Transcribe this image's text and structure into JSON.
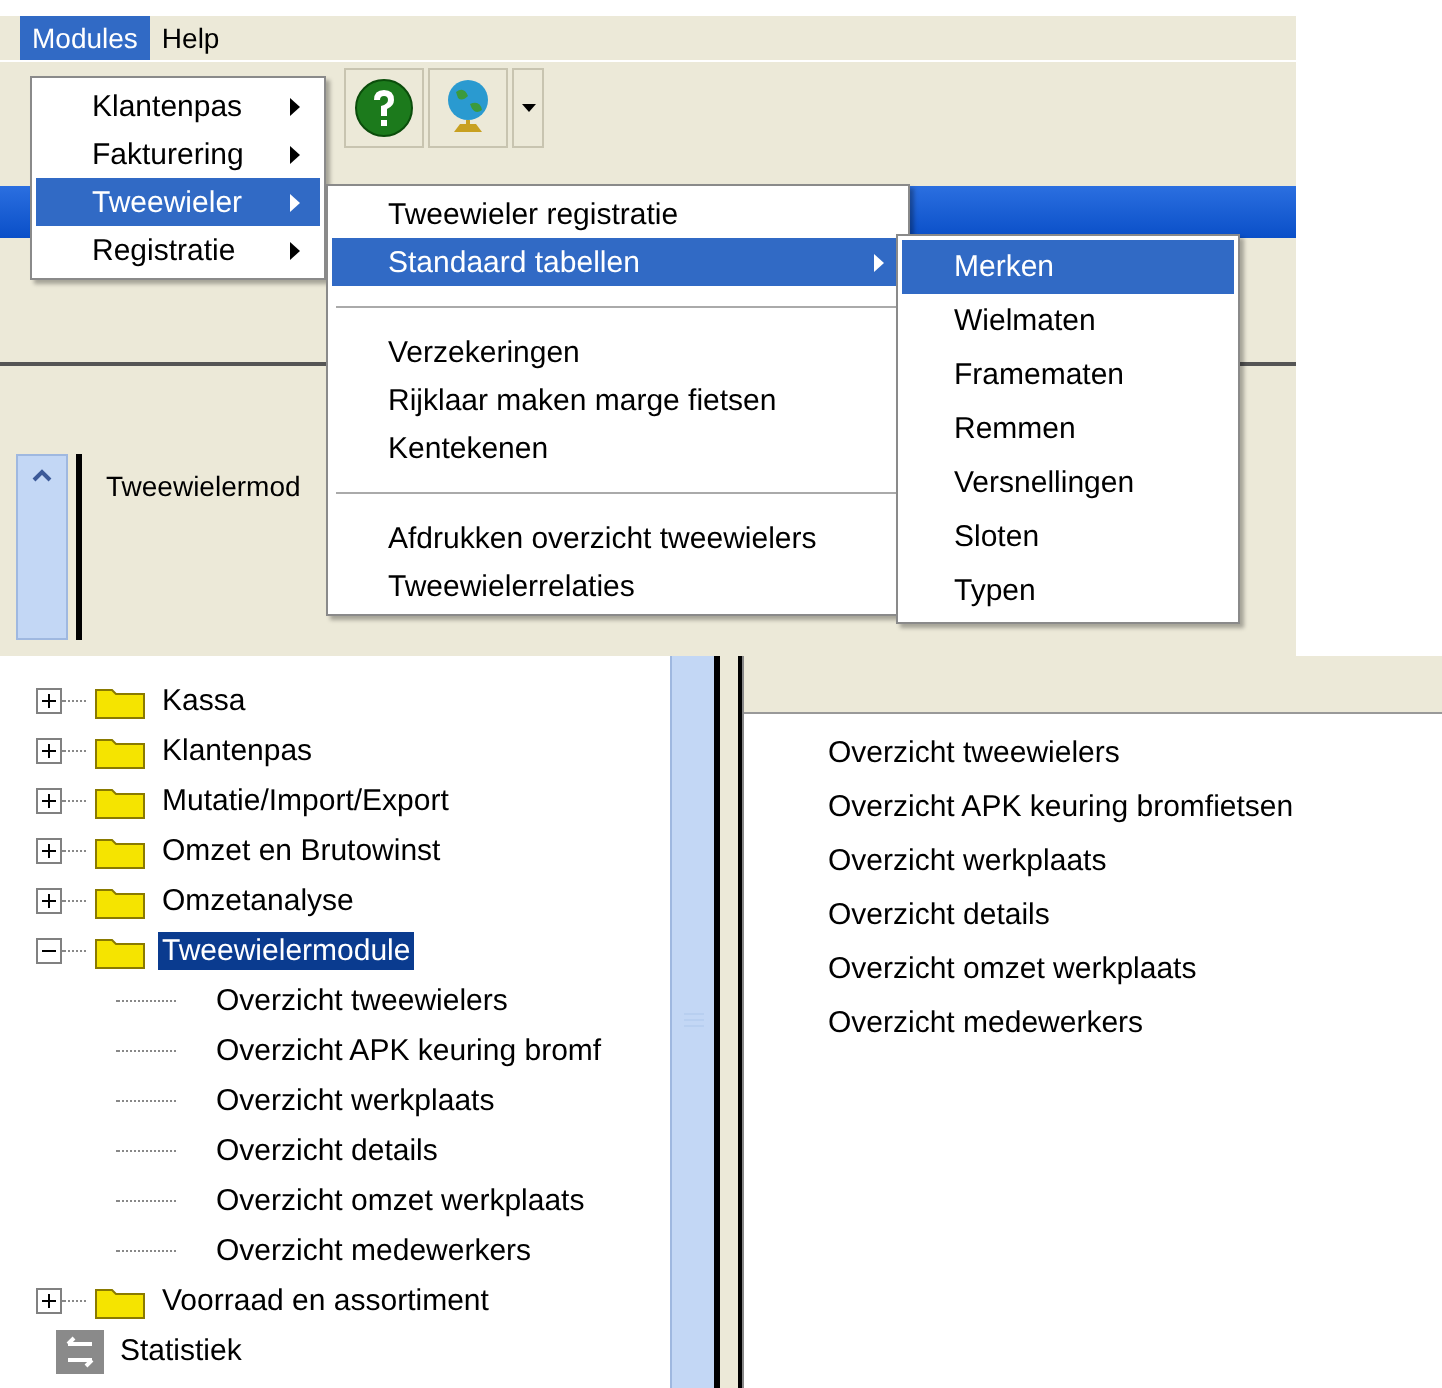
{
  "menu_bar": [
    {
      "label": "Modules",
      "selected": true
    },
    {
      "label": "Help",
      "selected": false
    }
  ],
  "modules_menu": [
    {
      "label": "Klantenpas",
      "selected": false
    },
    {
      "label": "Fakturering",
      "selected": false
    },
    {
      "label": "Tweewieler",
      "selected": true
    },
    {
      "label": "Registratie",
      "selected": false
    }
  ],
  "tweewieler_menu": [
    [
      {
        "label": "Tweewieler registratie",
        "submenu": false,
        "selected": false
      },
      {
        "label": "Standaard tabellen",
        "submenu": true,
        "selected": true
      }
    ],
    [
      {
        "label": "Verzekeringen",
        "submenu": false,
        "selected": false
      },
      {
        "label": "Rijklaar maken marge fietsen",
        "submenu": false,
        "selected": false
      },
      {
        "label": "Kentekenen",
        "submenu": false,
        "selected": false
      }
    ],
    [
      {
        "label": "Afdrukken overzicht tweewielers",
        "submenu": false,
        "selected": false
      },
      {
        "label": "Tweewielerrelaties",
        "submenu": false,
        "selected": false
      }
    ]
  ],
  "tabellen_menu": [
    {
      "label": "Merken",
      "selected": true
    },
    {
      "label": "Wielmaten",
      "selected": false
    },
    {
      "label": "Framematen",
      "selected": false
    },
    {
      "label": "Remmen",
      "selected": false
    },
    {
      "label": "Versnellingen",
      "selected": false
    },
    {
      "label": "Sloten",
      "selected": false
    },
    {
      "label": "Typen",
      "selected": false
    }
  ],
  "panel_header": "Tweewielermod",
  "tree": [
    {
      "label": "Kassa",
      "kind": "folder",
      "expanded": false,
      "selected": false
    },
    {
      "label": "Klantenpas",
      "kind": "folder",
      "expanded": false,
      "selected": false
    },
    {
      "label": "Mutatie/Import/Export",
      "kind": "folder",
      "expanded": false,
      "selected": false
    },
    {
      "label": "Omzet en Brutowinst",
      "kind": "folder",
      "expanded": false,
      "selected": false
    },
    {
      "label": "Omzetanalyse",
      "kind": "folder",
      "expanded": false,
      "selected": false
    },
    {
      "label": "Tweewielermodule",
      "kind": "folder",
      "expanded": true,
      "selected": true,
      "children": [
        {
          "label": "Overzicht tweewielers"
        },
        {
          "label": "Overzicht APK keuring bromf"
        },
        {
          "label": "Overzicht werkplaats"
        },
        {
          "label": "Overzicht details"
        },
        {
          "label": "Overzicht omzet werkplaats"
        },
        {
          "label": "Overzicht medewerkers"
        }
      ]
    },
    {
      "label": "Voorraad en assortiment",
      "kind": "folder",
      "expanded": false,
      "selected": false
    },
    {
      "label": "Statistiek",
      "kind": "statistics"
    }
  ],
  "report_list": [
    "Overzicht tweewielers",
    "Overzicht APK keuring bromfietsen",
    "Overzicht werkplaats",
    "Overzicht details",
    "Overzicht omzet werkplaats",
    "Overzicht medewerkers"
  ]
}
